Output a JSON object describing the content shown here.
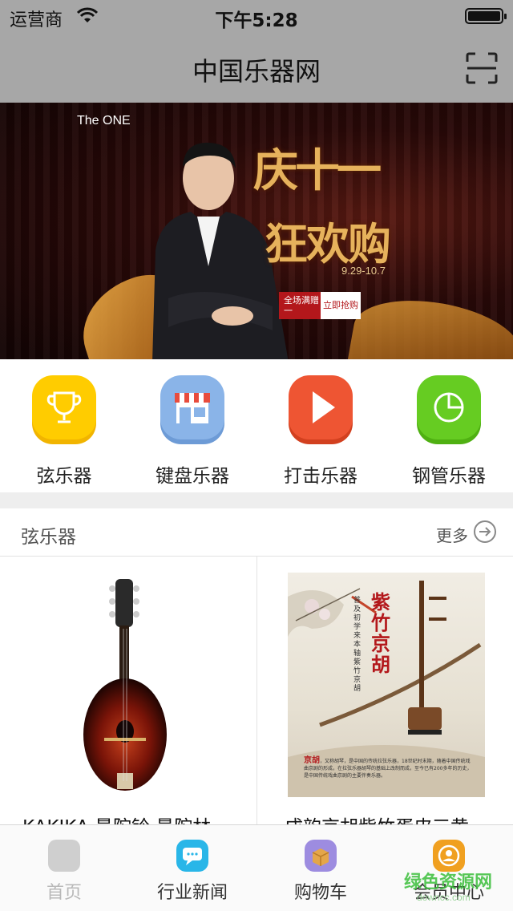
{
  "status_bar": {
    "carrier": "运营商",
    "time": "下午5:28"
  },
  "nav": {
    "title": "中国乐器网"
  },
  "banner": {
    "brand": "The ONE",
    "slogan_line1": "庆十一",
    "slogan_line2": "狂欢购",
    "dates": "9.29-10.7",
    "promo": "全场满赠 买一送一",
    "buy_label": "立即抢购",
    "slide_count": 5,
    "active_slide": 0
  },
  "categories": [
    {
      "label": "弦乐器",
      "icon": "trophy-icon",
      "color": "#ffcc00"
    },
    {
      "label": "键盘乐器",
      "icon": "shop-icon",
      "color": "#8ab4e8"
    },
    {
      "label": "打击乐器",
      "icon": "play-icon",
      "color": "#ee5533"
    },
    {
      "label": "钢管乐器",
      "icon": "pie-chart-icon",
      "color": "#66cc22"
    }
  ],
  "section": {
    "title": "弦乐器",
    "more_label": "更多"
  },
  "products": [
    {
      "name": "KAKIKA 曼陀铃 曼陀林",
      "image": "mandolin-image"
    },
    {
      "name": "成韵京胡紫竹蛋皮三黄",
      "image": "jinghu-poster-image",
      "poster_title": "紫竹京胡",
      "poster_sub": "普及初学来本轴紫竹京胡",
      "poster_caption_lead": "京胡",
      "poster_caption": "，又称胡琴，是中国的传统拉弦乐器，18世纪时末期，随着中国传统戏曲京剧的形成，在拉弦乐器胡琴的基础上改制而成，至今已有200多年的历史，是中国传统戏曲京剧的主要伴奏乐器。"
    }
  ],
  "tabbar": [
    {
      "label": "首页",
      "icon": "home-icon"
    },
    {
      "label": "行业新闻",
      "icon": "news-chat-icon"
    },
    {
      "label": "购物车",
      "icon": "cart-box-icon"
    },
    {
      "label": "会员中心",
      "icon": "member-icon"
    }
  ],
  "watermark": {
    "text": "绿色资源网",
    "url_text": "downcc.com"
  },
  "colors": {
    "nav_bg": "#a7a7a7",
    "accent_orange": "#f0a020"
  }
}
